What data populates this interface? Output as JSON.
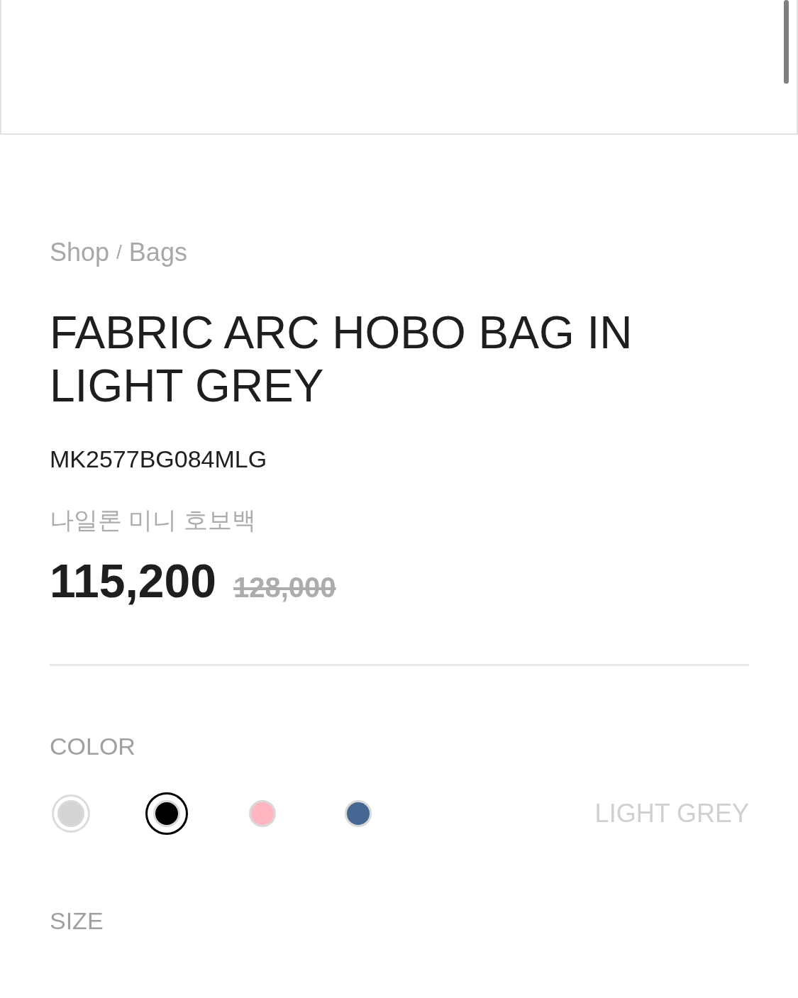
{
  "breadcrumb": {
    "parts": [
      "Shop",
      "Bags"
    ],
    "separator": "/"
  },
  "title": "FABRIC ARC HOBO BAG IN LIGHT GREY",
  "sku": "MK2577BG084MLG",
  "subtitle": "나일론 미니 호보백",
  "price": {
    "current": "115,200",
    "original": "128,000"
  },
  "color_option": {
    "label": "COLOR",
    "selected_name": "LIGHT GREY",
    "swatches": [
      {
        "color": "#d4d4d4",
        "selected": true,
        "focused": false
      },
      {
        "color": "#000000",
        "selected": false,
        "focused": true
      },
      {
        "color": "#ffb6c1",
        "selected": false,
        "focused": false
      },
      {
        "color": "#456791",
        "selected": false,
        "focused": false
      }
    ]
  },
  "size_option": {
    "label": "SIZE"
  }
}
